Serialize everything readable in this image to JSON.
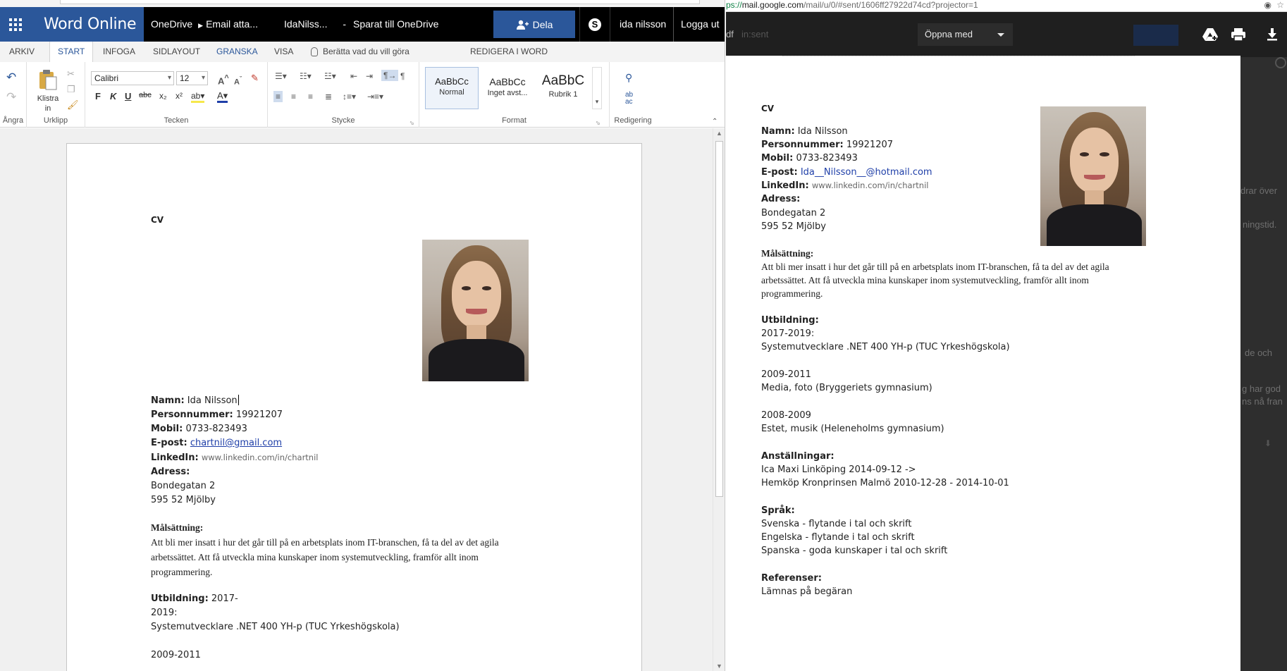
{
  "word": {
    "app_name": "Word Online",
    "breadcrumb": [
      "OneDrive",
      "Email atta..."
    ],
    "doc_name": "IdaNilss...",
    "separator": "-",
    "save_status": "Sparat till OneDrive",
    "share_label": "Dela",
    "skype_label": "S",
    "user_name": "ida nilsson",
    "logout_label": "Logga ut",
    "tabs": [
      "ARKIV",
      "START",
      "INFOGA",
      "SIDLAYOUT",
      "GRANSKA",
      "VISA"
    ],
    "active_tab": "START",
    "tell_me": "Berätta vad du vill göra",
    "edit_in_word": "REDIGERA I WORD",
    "ribbon": {
      "undo_group": "Ångra",
      "clipboard_group": "Urklipp",
      "paste_label": "Klistra in",
      "font_group": "Tecken",
      "font_name": "Calibri",
      "font_size": "12",
      "paragraph_group": "Stycke",
      "styles_group": "Format",
      "editing_group": "Redigering",
      "styles": [
        {
          "sample": "AaBbCc",
          "name": "Normal"
        },
        {
          "sample": "AaBbCc",
          "name": "Inget avst..."
        },
        {
          "sample": "AaBbC",
          "name": "Rubrik 1"
        }
      ],
      "bold": "F",
      "italic": "K",
      "underline": "U",
      "strike": "abc",
      "sub": "x₂",
      "sup": "x²"
    }
  },
  "cv": {
    "title": "CV",
    "name_label": "Namn:",
    "name": "Ida Nilsson",
    "pnr_label": "Personnummer:",
    "pnr": "19921207",
    "mobile_label": "Mobil:",
    "mobile": "0733-823493",
    "email_label": "E-post:",
    "email_word": "chartnil@gmail.com",
    "email_gmail": "Ida__Nilsson__@hotmail.com",
    "linkedin_label": "LinkedIn:",
    "linkedin": "www.linkedin.com/in/chartnil",
    "address_label": "Adress:",
    "street": "Bondegatan 2",
    "city": "595 52 Mjölby",
    "goal_label": "Målsättning:",
    "goal_line1_word": "Att bli mer insatt i hur det går till på en arbetsplats inom IT-branschen, få ta del av det agila",
    "goal_line2_word": "arbetssättet. Att få utveckla mina kunskaper inom systemutveckling, framför allt inom",
    "goal_line3_word": "programmering.",
    "goal_line1_gmail": "Att bli mer insatt i hur det går till på en arbetsplats inom IT-branschen, få ta del av det agila",
    "goal_line2_gmail": "arbetssättet. Att få utveckla mina kunskaper inom systemutveckling, framför allt inom",
    "goal_line3_gmail": "programmering.",
    "edu_label": "Utbildning:",
    "edu1_years_a": "2017-",
    "edu1_years_b": "2019:",
    "edu1_years_full": "2017-2019:",
    "edu1": "Systemutvecklare .NET 400 YH-p (TUC Yrkeshögskola)",
    "edu2_years": "2009-2011",
    "edu2": "Media, foto (Bryggeriets gymnasium)",
    "edu3_years": "2008-2009",
    "edu3": "Estet, musik (Heleneholms gymnasium)",
    "jobs_label": "Anställningar:",
    "job1": "Ica Maxi Linköping 2014-09-12 ->",
    "job2": "Hemköp Kronprinsen Malmö 2010-12-28 - 2014-10-01",
    "lang_label": "Språk:",
    "lang1_a": "Svenska",
    "lang1_b": " - flytande i tal och skrift",
    "lang2_a": "Engelska",
    "lang2_b": " - flytande i tal och skrift",
    "lang3_a": "Spanska",
    "lang3_b": " - goda kunskaper i tal och skrift",
    "ref_label": "Referenser:",
    "ref": "Lämnas på begäran"
  },
  "gmail": {
    "url_prefix": "ps://",
    "url_host": "mail.google.com",
    "url_path": "/mail/u/0/#sent/1606ff27922d74cd?projector=1",
    "pdf_label": "df",
    "search_ghost": "in:sent",
    "open_with": "Öppna med",
    "bg_snippets": [
      "drar över",
      "ningstid.",
      "de och",
      "g har god",
      "ns nå fran"
    ]
  },
  "colors": {
    "word_blue": "#2b579a",
    "app_bar": "#000000",
    "gmail_toolbar": "#1f1f1f",
    "link_blue": "#1f3fa8"
  }
}
